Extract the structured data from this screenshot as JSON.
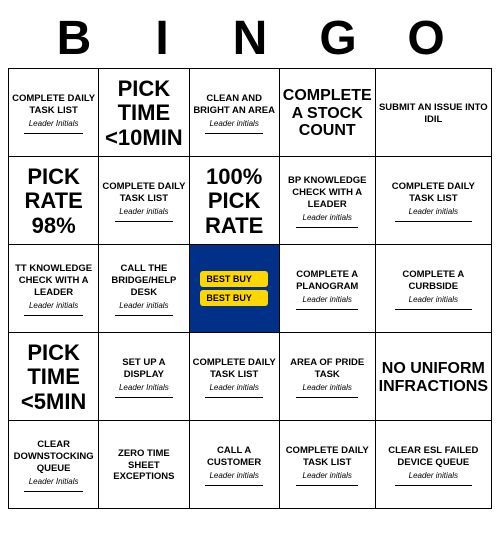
{
  "header": {
    "letters": [
      "B",
      "I",
      "N",
      "G",
      "O"
    ]
  },
  "grid": [
    [
      {
        "type": "normal",
        "main": "COMPLETE DAILY TASK LIST",
        "sub": "Leader Initials",
        "underline": true
      },
      {
        "type": "large",
        "main": "PICK TIME <10MIN",
        "sub": "",
        "underline": false
      },
      {
        "type": "normal",
        "main": "CLEAN AND BRIGHT AN AREA",
        "sub": "Leader initials",
        "underline": true
      },
      {
        "type": "medium",
        "main": "COMPLETE A STOCK COUNT",
        "sub": "",
        "underline": false
      },
      {
        "type": "normal",
        "main": "SUBMIT AN ISSUE INTO IDIL",
        "sub": "",
        "underline": false
      }
    ],
    [
      {
        "type": "large",
        "main": "PICK RATE 98%",
        "sub": "",
        "underline": false
      },
      {
        "type": "normal",
        "main": "COMPLETE DAILY TASK LIST",
        "sub": "Leader initials",
        "underline": true
      },
      {
        "type": "large",
        "main": "100% PICK RATE",
        "sub": "",
        "underline": false
      },
      {
        "type": "normal",
        "main": "BP KNOWLEDGE CHECK WITH A LEADER",
        "sub": "Leader initials",
        "underline": true
      },
      {
        "type": "normal",
        "main": "COMPLETE DAILY TASK LIST",
        "sub": "Leader initials",
        "underline": true
      }
    ],
    [
      {
        "type": "normal",
        "main": "TT KNOWLEDGE CHECK WITH A LEADER",
        "sub": "Leader initials",
        "underline": true
      },
      {
        "type": "normal",
        "main": "CALL THE BRIDGE/HELP DESK",
        "sub": "Leader initials",
        "underline": true
      },
      {
        "type": "free",
        "main": "",
        "sub": ""
      },
      {
        "type": "normal",
        "main": "COMPLETE A PLANOGRAM",
        "sub": "Leader initials",
        "underline": true
      },
      {
        "type": "normal",
        "main": "COMPLETE A CURBSIDE",
        "sub": "Leader initials",
        "underline": true
      }
    ],
    [
      {
        "type": "large",
        "main": "PICK TIME <5MIN",
        "sub": "",
        "underline": false
      },
      {
        "type": "normal",
        "main": "SET UP A DISPLAY",
        "sub": "Leader Initials",
        "underline": true
      },
      {
        "type": "normal",
        "main": "COMPLETE DAILY TASK LIST",
        "sub": "Leader initials",
        "underline": true
      },
      {
        "type": "normal",
        "main": "AREA OF PRIDE TASK",
        "sub": "Leader initials",
        "underline": true
      },
      {
        "type": "medium",
        "main": "NO UNIFORM INFRACTIONS",
        "sub": "",
        "underline": false
      }
    ],
    [
      {
        "type": "normal",
        "main": "CLEAR DOWNSTOCKING QUEUE",
        "sub": "Leader Initials",
        "underline": true
      },
      {
        "type": "normal",
        "main": "ZERO TIME SHEET EXCEPTIONS",
        "sub": "",
        "underline": false
      },
      {
        "type": "normal",
        "main": "CALL A CUSTOMER",
        "sub": "Leader initials",
        "underline": true
      },
      {
        "type": "normal",
        "main": "COMPLETE DAILY TASK LIST",
        "sub": "Leader initials",
        "underline": true
      },
      {
        "type": "normal",
        "main": "CLEAR ESL FAILED DEVICE QUEUE",
        "sub": "Leader initials",
        "underline": true
      }
    ]
  ]
}
